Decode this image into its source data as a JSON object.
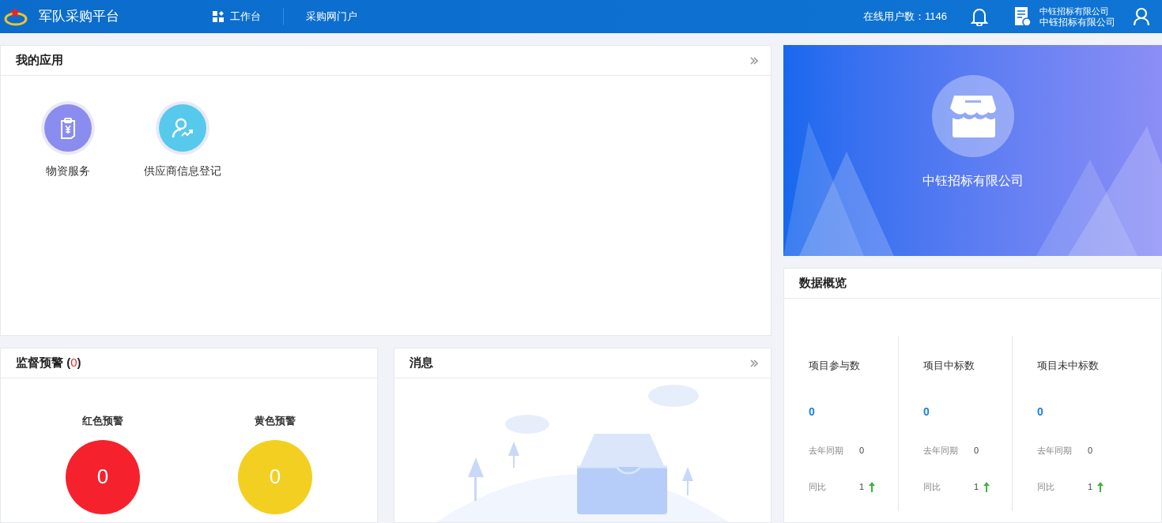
{
  "header": {
    "title": "军队采购平台",
    "nav": [
      {
        "label": "工作台",
        "kind": "grid",
        "selected": false
      },
      {
        "label": "采购网门户",
        "kind": "plain",
        "selected": false
      }
    ],
    "online_label": "在线用户数：1146",
    "company_lines": [
      "中钰招标有限公司",
      "中钰招标有限公司"
    ]
  },
  "apps": {
    "title": "我的应用",
    "items": [
      {
        "label": "物资服务",
        "color": "#8b8cf0",
        "kind": "clipboard"
      },
      {
        "label": "供应商信息登记",
        "color": "#57c9ec",
        "kind": "person"
      }
    ]
  },
  "warnings": {
    "title": "监督预警",
    "open": "(",
    "count": "0",
    "close": ")",
    "items": [
      {
        "label": "红色预警",
        "value": "0",
        "color": "#f5222d"
      },
      {
        "label": "黄色预警",
        "value": "0",
        "color": "#f3cf22"
      }
    ]
  },
  "messages": {
    "title": "消息"
  },
  "banner": {
    "company": "中钰招标有限公司"
  },
  "overview": {
    "title": "数据概览",
    "stats": [
      {
        "label": "项目参与数",
        "value": "0",
        "last_year_label": "去年同期",
        "last_year_value": "0",
        "ratio_label": "同比",
        "ratio_value": "1",
        "kind": "up"
      },
      {
        "label": "项目中标数",
        "value": "0",
        "last_year_label": "去年同期",
        "last_year_value": "0",
        "ratio_label": "同比",
        "ratio_value": "1",
        "kind": "up"
      },
      {
        "label": "项目未中标数",
        "value": "0",
        "last_year_label": "去年同期",
        "last_year_value": "0",
        "ratio_label": "同比",
        "ratio_value": "1",
        "kind": "up"
      }
    ]
  }
}
